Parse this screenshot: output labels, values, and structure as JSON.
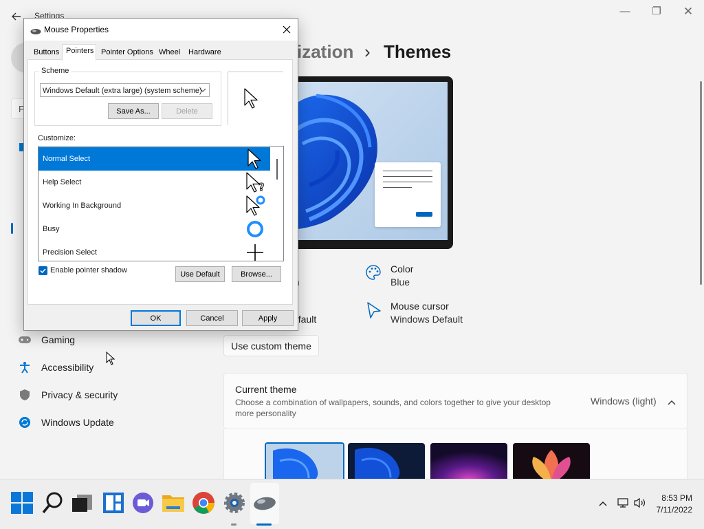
{
  "settings": {
    "window_title": "Settings",
    "breadcrumb_parent": "ization",
    "breadcrumb_separator": "›",
    "breadcrumb_current": "Themes",
    "search_placeholder": "F",
    "nav_items": [
      {
        "label": "Gaming",
        "icon": "gaming-icon"
      },
      {
        "label": "Accessibility",
        "icon": "accessibility-icon"
      },
      {
        "label": "Privacy & security",
        "icon": "shield-icon"
      },
      {
        "label": "Windows Update",
        "icon": "windows-update-icon"
      }
    ],
    "properties": {
      "left_partial_1": "l",
      "left_partial_2": "n",
      "left_partial_3": "efault",
      "color_label": "Color",
      "color_value": "Blue",
      "cursor_label": "Mouse cursor",
      "cursor_value": "Windows Default"
    },
    "custom_theme_button": "Use custom theme",
    "current_theme": {
      "title": "Current theme",
      "description": "Choose a combination of wallpapers, sounds, and colors together to give your desktop more personality",
      "value": "Windows (light)"
    },
    "accent_color": "#0067c0"
  },
  "dialog": {
    "title": "Mouse Properties",
    "tabs": [
      "Buttons",
      "Pointers",
      "Pointer Options",
      "Wheel",
      "Hardware"
    ],
    "active_tab": "Pointers",
    "scheme_label": "Scheme",
    "scheme_value": "Windows Default (extra large) (system scheme)",
    "save_as_label": "Save As...",
    "delete_label": "Delete",
    "customize_label": "Customize:",
    "pointers": [
      {
        "label": "Normal Select",
        "icon": "arrow-cursor-icon",
        "selected": true
      },
      {
        "label": "Help Select",
        "icon": "help-cursor-icon",
        "selected": false
      },
      {
        "label": "Working In Background",
        "icon": "working-cursor-icon",
        "selected": false
      },
      {
        "label": "Busy",
        "icon": "busy-cursor-icon",
        "selected": false
      },
      {
        "label": "Precision Select",
        "icon": "crosshair-cursor-icon",
        "selected": false
      }
    ],
    "shadow_label": "Enable pointer shadow",
    "shadow_checked": true,
    "use_default_label": "Use Default",
    "browse_label": "Browse...",
    "ok_label": "OK",
    "cancel_label": "Cancel",
    "apply_label": "Apply"
  },
  "taskbar": {
    "icons": [
      "start-icon",
      "search-icon",
      "task-view-icon",
      "widgets-icon",
      "chat-icon",
      "file-explorer-icon",
      "chrome-icon",
      "settings-icon",
      "mouse-app-icon"
    ],
    "time": "8:53 PM",
    "date": "7/11/2022"
  }
}
